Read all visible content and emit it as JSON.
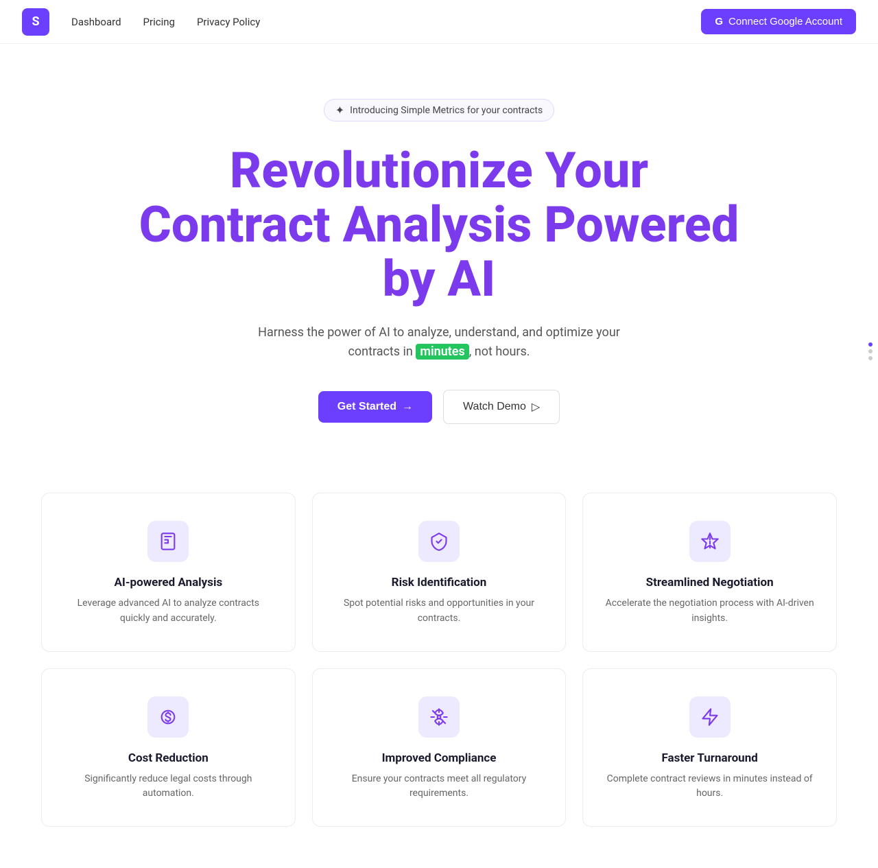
{
  "nav": {
    "logo": "S",
    "links": [
      {
        "label": "Dashboard",
        "id": "dashboard"
      },
      {
        "label": "Pricing",
        "id": "pricing"
      },
      {
        "label": "Privacy Policy",
        "id": "privacy"
      }
    ],
    "cta_label": "Connect Google Account",
    "cta_icon": "G"
  },
  "hero": {
    "badge_icon": "✦",
    "badge_text": "Introducing Simple Metrics for your contracts",
    "title": "Revolutionize Your Contract Analysis Powered by AI",
    "subtitle_pre": "Harness the power of AI to analyze, understand, and optimize your contracts in ",
    "subtitle_highlight": "minutes",
    "subtitle_post": ", not hours.",
    "btn_primary": "Get Started",
    "btn_primary_icon": "→",
    "btn_secondary": "Watch Demo",
    "btn_secondary_icon": "▷"
  },
  "features": {
    "row1": [
      {
        "icon": "📄",
        "title": "AI-powered Analysis",
        "desc": "Leverage advanced AI to analyze contracts quickly and accurately."
      },
      {
        "icon": "🛡",
        "title": "Risk Identification",
        "desc": "Spot potential risks and opportunities in your contracts."
      },
      {
        "icon": "⏳",
        "title": "Streamlined Negotiation",
        "desc": "Accelerate the negotiation process with AI-driven insights."
      }
    ],
    "row2": [
      {
        "icon": "🐷",
        "title": "Cost Reduction",
        "desc": "Significantly reduce legal costs through automation."
      },
      {
        "icon": "⚖",
        "title": "Improved Compliance",
        "desc": "Ensure your contracts meet all regulatory requirements."
      },
      {
        "icon": "⚡",
        "title": "Faster Turnaround",
        "desc": "Complete contract reviews in minutes instead of hours."
      }
    ]
  }
}
